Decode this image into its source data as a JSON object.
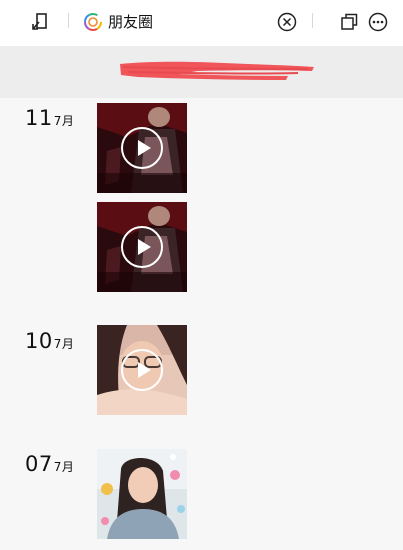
{
  "toolbar": {
    "title": "朋友圈",
    "icons": [
      "minimize-icon",
      "moments-logo-icon",
      "close-circle-icon",
      "copy-window-icon",
      "more-icon"
    ]
  },
  "header": {
    "redacted_text": "redacted"
  },
  "posts": [
    {
      "day": "11",
      "month": "7月",
      "media": [
        "video",
        "video"
      ]
    },
    {
      "day": "10",
      "month": "7月",
      "media": [
        "video"
      ]
    },
    {
      "day": "07",
      "month": "7月",
      "media": [
        "photo"
      ]
    }
  ],
  "colors": {
    "background": "#f7f7f7",
    "header_band": "#ededed",
    "redaction": "#f0555a"
  }
}
